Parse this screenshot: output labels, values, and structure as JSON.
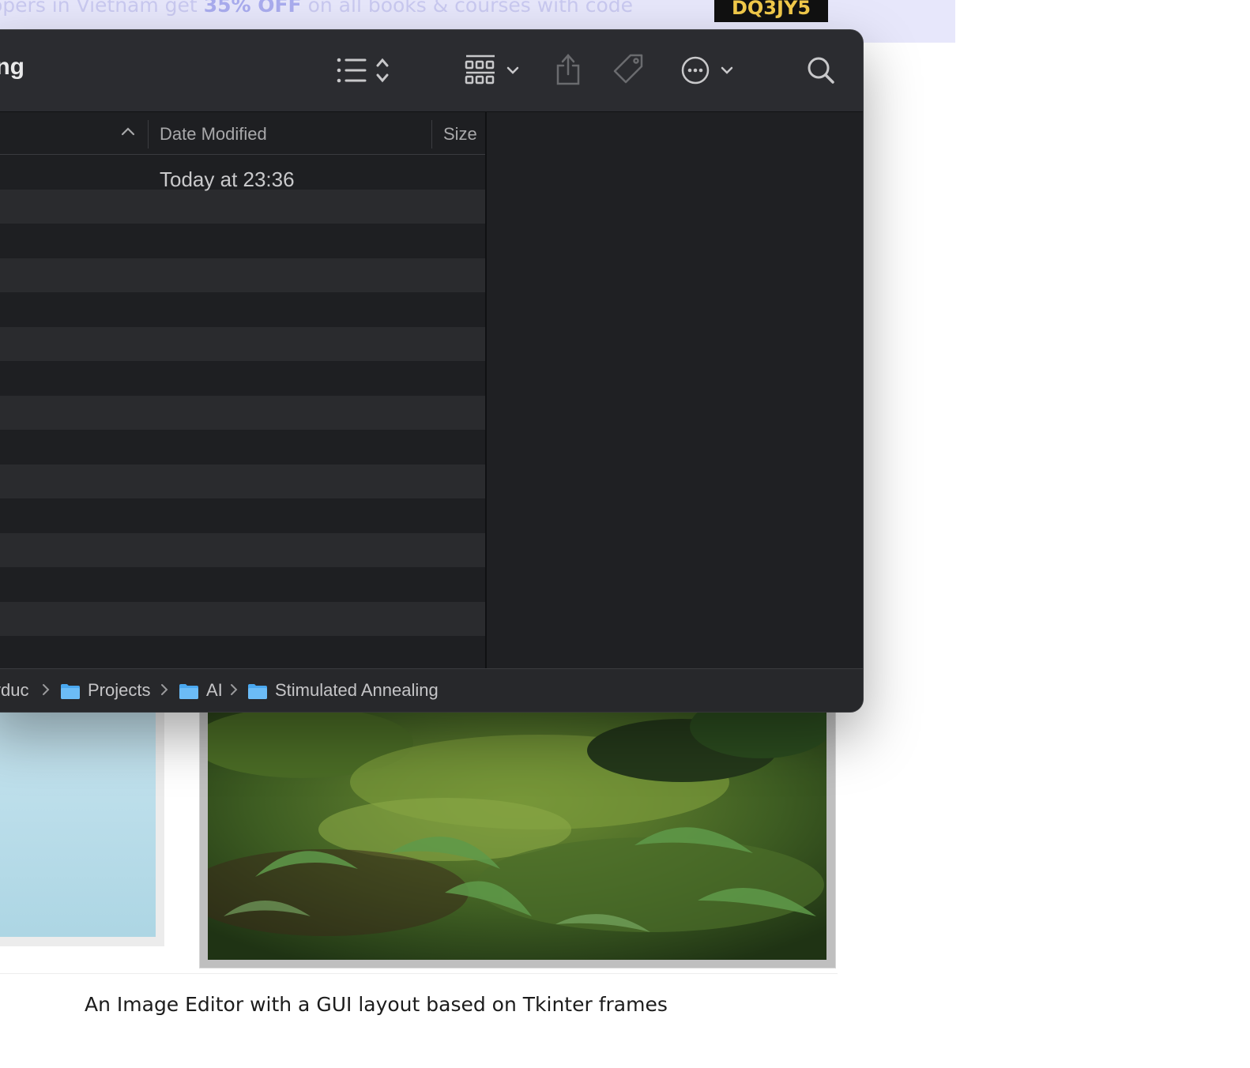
{
  "banner": {
    "text_prefix": "opers in Vietnam get ",
    "highlight": "35% OFF",
    "text_suffix": " on all books & courses with code",
    "coupon_code": "DQ3JY5"
  },
  "article": {
    "caption": "An Image Editor with a GUI layout based on Tkinter frames"
  },
  "finder": {
    "title": "ing",
    "toolbar": {
      "list_view_icon": "list-icon",
      "group_icon": "grid-icon",
      "share_icon": "share-icon",
      "tag_icon": "tag-icon",
      "more_icon": "ellipsis-circle-icon",
      "search_icon": "search-icon"
    },
    "columns": {
      "date_modified": "Date Modified",
      "size": "Size"
    },
    "rows": [
      {
        "date_modified": "Today at 23:36"
      }
    ],
    "path": [
      {
        "label": "yduc"
      },
      {
        "label": "Projects"
      },
      {
        "label": "AI"
      },
      {
        "label": "Stimulated Annealing"
      }
    ],
    "colors": {
      "folder": "#4aa8f0",
      "window_bg": "#1e1f22",
      "toolbar_bg": "#2b2c30"
    }
  }
}
